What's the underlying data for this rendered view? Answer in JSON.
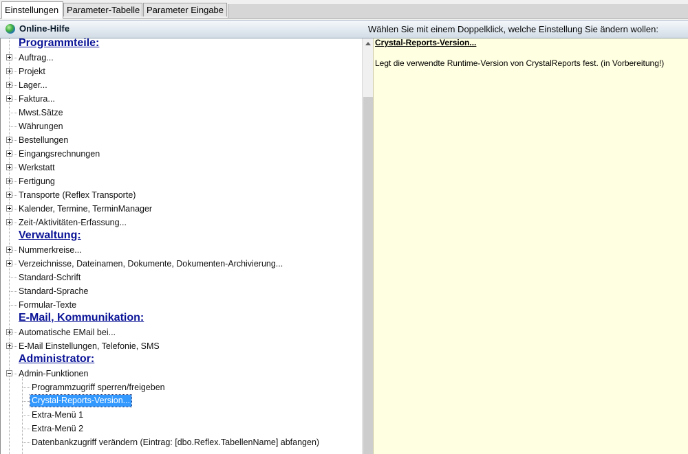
{
  "tabs": [
    {
      "label": "Einstellungen",
      "active": true
    },
    {
      "label": "Parameter-Tabelle",
      "active": false
    },
    {
      "label": "Parameter Eingabe",
      "active": false
    }
  ],
  "helpbar": {
    "title": "Online-Hilfe",
    "hint": "Wählen Sie mit einem Doppelklick, welche Einstellung Sie ändern wollen:",
    "icon": "globe-icon"
  },
  "tree": {
    "items": [
      {
        "label": "Programmteile:",
        "type": "heading"
      },
      {
        "label": "Auftrag...",
        "expander": "plus"
      },
      {
        "label": "Projekt",
        "expander": "plus"
      },
      {
        "label": "Lager...",
        "expander": "plus"
      },
      {
        "label": "Faktura...",
        "expander": "plus"
      },
      {
        "label": "Mwst.Sätze",
        "expander": "none"
      },
      {
        "label": "Währungen",
        "expander": "none"
      },
      {
        "label": "Bestellungen",
        "expander": "plus"
      },
      {
        "label": "Eingangsrechnungen",
        "expander": "plus"
      },
      {
        "label": "Werkstatt",
        "expander": "plus"
      },
      {
        "label": "Fertigung",
        "expander": "plus"
      },
      {
        "label": "Transporte (Reflex Transporte)",
        "expander": "plus"
      },
      {
        "label": "Kalender, Termine, TerminManager",
        "expander": "plus"
      },
      {
        "label": "Zeit-/Aktivitäten-Erfassung...",
        "expander": "plus"
      },
      {
        "label": "Verwaltung:",
        "type": "heading"
      },
      {
        "label": "Nummerkreise...",
        "expander": "plus"
      },
      {
        "label": "Verzeichnisse, Dateinamen, Dokumente, Dokumenten-Archivierung...",
        "expander": "plus"
      },
      {
        "label": "Standard-Schrift",
        "expander": "none"
      },
      {
        "label": "Standard-Sprache",
        "expander": "none"
      },
      {
        "label": "Formular-Texte",
        "expander": "none"
      },
      {
        "label": "E-Mail, Kommunikation:",
        "type": "heading"
      },
      {
        "label": "Automatische EMail bei...",
        "expander": "plus"
      },
      {
        "label": "E-Mail Einstellungen, Telefonie, SMS",
        "expander": "plus"
      },
      {
        "label": "Administrator:",
        "type": "heading"
      },
      {
        "label": "Admin-Funktionen",
        "expander": "minus"
      },
      {
        "label": "Programmzugriff sperren/freigeben",
        "level": 2
      },
      {
        "label": "Crystal-Reports-Version...",
        "level": 2,
        "selected": true
      },
      {
        "label": "Extra-Menü 1",
        "level": 2
      },
      {
        "label": "Extra-Menü 2",
        "level": 2
      },
      {
        "label": "Datenbankzugriff verändern (Eintrag: [dbo.Reflex.TabellenName] abfangen)",
        "level": 2
      }
    ]
  },
  "description": {
    "title": "Crystal-Reports-Version...",
    "text": "Legt die verwendte Runtime-Version von CrystalReports fest. (in Vorbereitung!)"
  },
  "colors": {
    "heading": "#0a1396",
    "selection": "#3399ff",
    "description_bg": "#ffffe1"
  }
}
